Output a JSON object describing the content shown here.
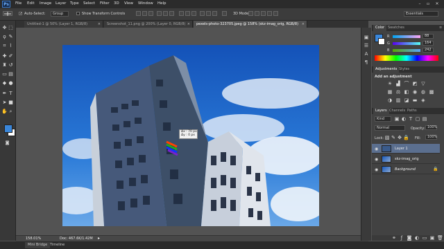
{
  "app": {
    "logo": "Ps"
  },
  "menu": [
    "File",
    "Edit",
    "Image",
    "Layer",
    "Type",
    "Select",
    "Filter",
    "3D",
    "View",
    "Window",
    "Help"
  ],
  "window_controls": {
    "minimize": "–",
    "restore": "▫",
    "close": "✕"
  },
  "options_bar": {
    "auto_select_label": "Auto-Select:",
    "auto_select_checked": "✓",
    "auto_select_value": "Group",
    "transform_label": "Show Transform Controls",
    "mode_3d_label": "3D Mode:",
    "workspace": "Essentials"
  },
  "tabs": [
    {
      "label": "Untitled-1 @ 50% (Layer 1, RGB/8)",
      "close": "×"
    },
    {
      "label": "Screenshot_11.png @ 200% (Layer 0, RGB/8)",
      "close": "×"
    },
    {
      "label": "pexels-photo-323705.jpeg @ 158% (skz-imag_orig, RGB/8)",
      "close": "×"
    }
  ],
  "move_tooltip": {
    "dx": "Δx : 70 px",
    "dy": "Δy : 0 px"
  },
  "status": {
    "zoom": "158.01%",
    "doc": "Doc: 467.6K/1.42M"
  },
  "bottom_tabs": [
    "Mini Bridge",
    "Timeline"
  ],
  "colors": {
    "accent": "#2d7bd1",
    "foreground": "#3a86d9",
    "background": "#ffffff",
    "sky": "#1b66c9"
  },
  "panels": {
    "color": {
      "tabs": [
        "Color",
        "Swatches"
      ],
      "channels": [
        {
          "label": "R",
          "value": "88"
        },
        {
          "label": "G",
          "value": "164"
        },
        {
          "label": "B",
          "value": "242"
        }
      ]
    },
    "adjustments": {
      "tabs": [
        "Adjustments",
        "Styles"
      ],
      "title": "Add an adjustment"
    },
    "layers": {
      "tabs": [
        "Layers",
        "Channels",
        "Paths"
      ],
      "kind": "Kind",
      "blend_mode": "Normal",
      "opacity_label": "Opacity:",
      "opacity": "100%",
      "lock_label": "Lock:",
      "fill_label": "Fill:",
      "fill": "100%",
      "items": [
        {
          "name": "Layer 1",
          "visible": "👁"
        },
        {
          "name": "skz-imag_orig",
          "visible": "👁"
        },
        {
          "name": "Background",
          "visible": "👁"
        }
      ]
    }
  },
  "tool_icons": [
    "move-icon",
    "marquee-icon",
    "lasso-icon",
    "quick-select-icon",
    "crop-icon",
    "eyedropper-icon",
    "healing-icon",
    "brush-icon",
    "clone-stamp-icon",
    "history-brush-icon",
    "eraser-icon",
    "gradient-icon",
    "blur-icon",
    "dodge-icon",
    "pen-icon",
    "type-icon",
    "path-select-icon",
    "shape-icon",
    "hand-icon",
    "zoom-icon"
  ]
}
